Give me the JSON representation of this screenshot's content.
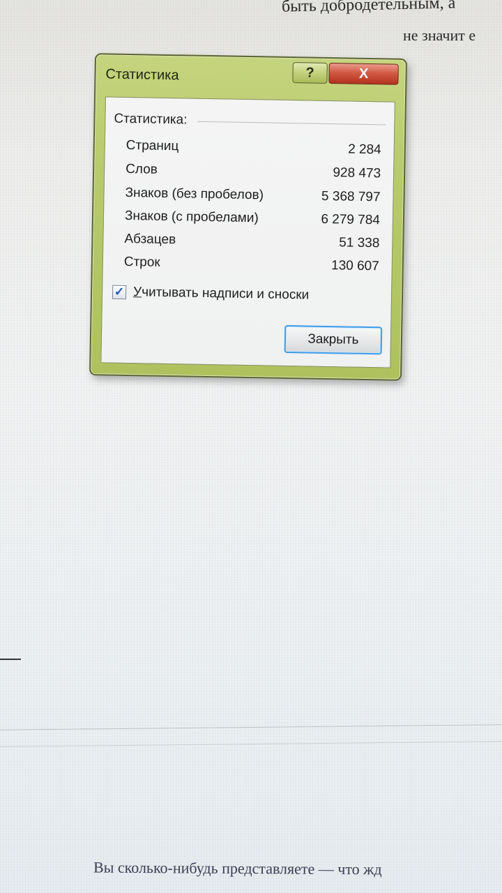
{
  "document": {
    "top_line_1": "быть добродетельным, а",
    "top_line_2": "не значит е",
    "bottom_line": "Вы сколько-нибудь представляете — что жд"
  },
  "dialog": {
    "title": "Статистика",
    "help_glyph": "?",
    "close_glyph": "X",
    "group_label": "Статистика:",
    "stats": [
      {
        "label": "Страниц",
        "value": "2 284"
      },
      {
        "label": "Слов",
        "value": "928 473"
      },
      {
        "label": "Знаков (без пробелов)",
        "value": "5 368 797"
      },
      {
        "label": "Знаков (с пробелами)",
        "value": "6 279 784"
      },
      {
        "label": "Абзацев",
        "value": "51 338"
      },
      {
        "label": "Строк",
        "value": "130 607"
      }
    ],
    "checkbox": {
      "mnemonic": "У",
      "label_rest": "читывать надписи и сноски",
      "checked": true,
      "check_glyph": "✓"
    },
    "close_button_label": "Закрыть"
  },
  "colors": {
    "frame": "#b7c96a",
    "close_red": "#d15a45",
    "focus_blue": "#3d9be8"
  }
}
